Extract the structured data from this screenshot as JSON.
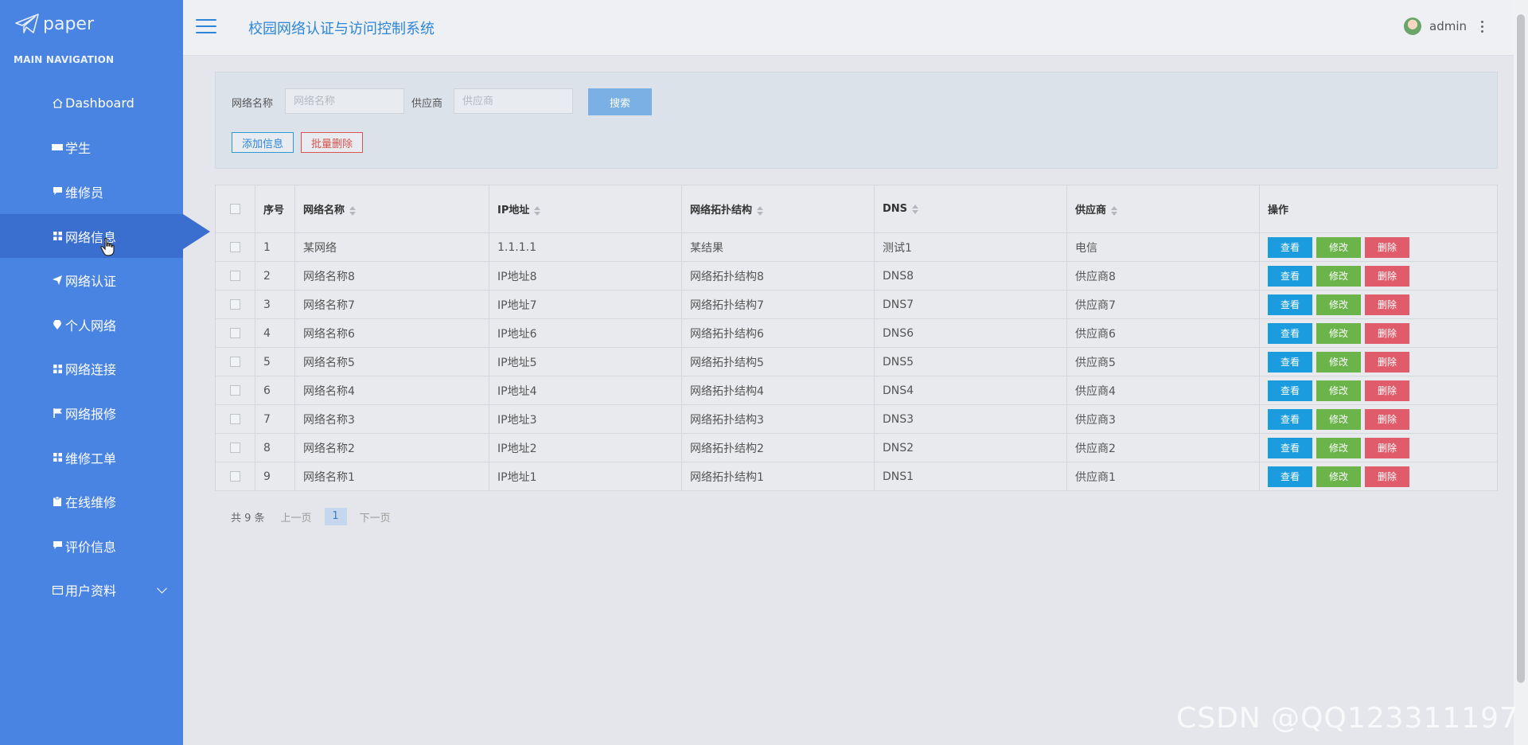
{
  "brand": {
    "name": "paper",
    "nav_title": "MAIN NAVIGATION"
  },
  "sidebar": {
    "items": [
      {
        "label": "Dashboard",
        "icon": "home-icon"
      },
      {
        "label": "学生",
        "icon": "ticket-icon"
      },
      {
        "label": "维修员",
        "icon": "comment-icon"
      },
      {
        "label": "网络信息",
        "icon": "grid-icon",
        "active": true
      },
      {
        "label": "网络认证",
        "icon": "send-icon"
      },
      {
        "label": "个人网络",
        "icon": "location-pin-icon"
      },
      {
        "label": "网络连接",
        "icon": "grid-icon"
      },
      {
        "label": "网络报修",
        "icon": "flag-icon"
      },
      {
        "label": "维修工单",
        "icon": "grid-icon"
      },
      {
        "label": "在线维修",
        "icon": "clipboard-icon"
      },
      {
        "label": "评价信息",
        "icon": "comment-icon"
      },
      {
        "label": "用户资料",
        "icon": "id-card-icon",
        "expandable": true
      }
    ]
  },
  "header": {
    "title": "校园网络认证与访问控制系统",
    "username": "admin"
  },
  "filter": {
    "name_label": "网络名称",
    "name_placeholder": "网络名称",
    "supplier_label": "供应商",
    "supplier_placeholder": "供应商",
    "search_label": "搜索",
    "add_label": "添加信息",
    "batch_delete_label": "批量删除"
  },
  "table": {
    "headers": {
      "no": "序号",
      "name": "网络名称",
      "ip": "IP地址",
      "topology": "网络拓扑结构",
      "dns": "DNS",
      "supplier": "供应商",
      "actions": "操作"
    },
    "action_labels": {
      "view": "查看",
      "edit": "修改",
      "delete": "删除"
    },
    "rows": [
      {
        "no": "1",
        "name": "某网络",
        "ip": "1.1.1.1",
        "topology": "某结果",
        "dns": "测试1",
        "supplier": "电信"
      },
      {
        "no": "2",
        "name": "网络名称8",
        "ip": "IP地址8",
        "topology": "网络拓扑结构8",
        "dns": "DNS8",
        "supplier": "供应商8"
      },
      {
        "no": "3",
        "name": "网络名称7",
        "ip": "IP地址7",
        "topology": "网络拓扑结构7",
        "dns": "DNS7",
        "supplier": "供应商7"
      },
      {
        "no": "4",
        "name": "网络名称6",
        "ip": "IP地址6",
        "topology": "网络拓扑结构6",
        "dns": "DNS6",
        "supplier": "供应商6"
      },
      {
        "no": "5",
        "name": "网络名称5",
        "ip": "IP地址5",
        "topology": "网络拓扑结构5",
        "dns": "DNS5",
        "supplier": "供应商5"
      },
      {
        "no": "6",
        "name": "网络名称4",
        "ip": "IP地址4",
        "topology": "网络拓扑结构4",
        "dns": "DNS4",
        "supplier": "供应商4"
      },
      {
        "no": "7",
        "name": "网络名称3",
        "ip": "IP地址3",
        "topology": "网络拓扑结构3",
        "dns": "DNS3",
        "supplier": "供应商3"
      },
      {
        "no": "8",
        "name": "网络名称2",
        "ip": "IP地址2",
        "topology": "网络拓扑结构2",
        "dns": "DNS2",
        "supplier": "供应商2"
      },
      {
        "no": "9",
        "name": "网络名称1",
        "ip": "IP地址1",
        "topology": "网络拓扑结构1",
        "dns": "DNS1",
        "supplier": "供应商1"
      }
    ]
  },
  "pagination": {
    "total": "共 9 条",
    "prev": "上一页",
    "current": "1",
    "next": "下一页"
  },
  "watermark": "CSDN @QQ123311197",
  "colors": {
    "sidebar": "#4a84e2",
    "accent": "#2d86d9",
    "view": "#1a9cde",
    "edit": "#6ab44a",
    "delete": "#e05c6a"
  }
}
